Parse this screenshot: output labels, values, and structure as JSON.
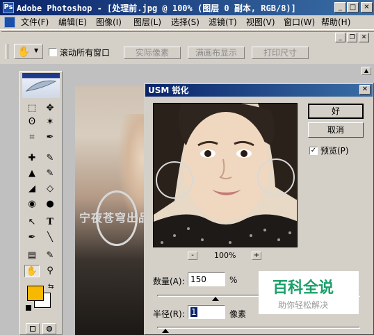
{
  "window": {
    "title": "Adobe Photoshop - [处理前.jpg @ 100% (图层 0 副本, RGB/8)]",
    "app_icon_letter": "Ps",
    "controls": {
      "minimize": "_",
      "maximize": "□",
      "close": "✕"
    }
  },
  "menu": {
    "items": [
      "文件(F)",
      "编辑(E)",
      "图像(I)",
      "图层(L)",
      "选择(S)",
      "滤镜(T)",
      "视图(V)",
      "窗口(W)",
      "帮助(H)"
    ],
    "doc_controls": {
      "minimize": "_",
      "restore": "❐",
      "close": "✕"
    }
  },
  "options_bar": {
    "scroll_all_windows_label": "滚动所有窗口",
    "scroll_all_windows_checked": false,
    "buttons": [
      "实际像素",
      "满画布显示",
      "打印尺寸"
    ]
  },
  "canvas": {
    "watermark_text": "宁夜苍穹出品"
  },
  "toolbox": {
    "tools": [
      "⬚",
      "✥",
      "ʘ",
      "✶",
      "⌗",
      "✒",
      "✚",
      "✎",
      "▲",
      "✎",
      "◢",
      "◇",
      "◉",
      "●",
      "↖",
      "T",
      "✒",
      "╲",
      "▤",
      "✎",
      "✋",
      "⚲"
    ],
    "foreground_color": "#f6b800",
    "background_color": "#ffffff"
  },
  "dialog": {
    "title": "USM 锐化",
    "ok_label": "好",
    "cancel_label": "取消",
    "preview_label": "预览(P)",
    "preview_checked": true,
    "zoom_minus": "-",
    "zoom_plus": "+",
    "zoom_level": "100%",
    "amount_label": "数量(A):",
    "amount_value": "150",
    "amount_unit": "%",
    "radius_label": "半径(R):",
    "radius_value": "1",
    "radius_unit": "像素"
  },
  "watermark": {
    "title": "百科全说",
    "subtitle": "助你轻松解决"
  }
}
